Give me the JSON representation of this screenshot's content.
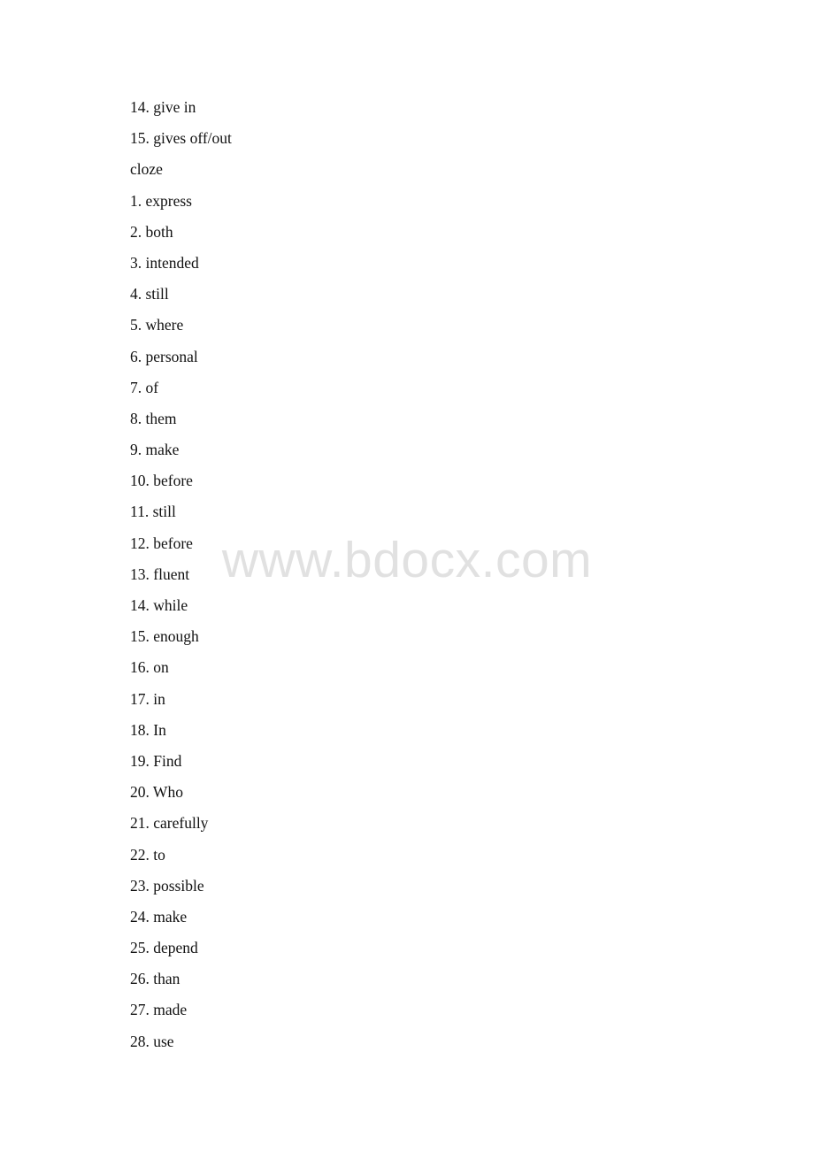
{
  "document": {
    "lines": [
      "14. give in",
      "15. gives off/out",
      "cloze",
      "1. express",
      "2. both",
      "3. intended",
      "4. still",
      "5. where",
      "6. personal",
      "7. of",
      "8. them",
      "9. make",
      "10. before",
      "11. still",
      "12. before",
      "13. fluent",
      "14. while",
      "15. enough",
      "16. on",
      "17. in",
      "18. In",
      "19. Find",
      "20. Who",
      "21. carefully",
      "22. to",
      "23. possible",
      "24. make",
      "25. depend",
      "26. than",
      "27. made",
      "28. use"
    ],
    "watermark": "www.bdocx.com"
  },
  "colors": {
    "text": "#111111",
    "watermark": "#e1e1e1",
    "background": "#ffffff"
  }
}
